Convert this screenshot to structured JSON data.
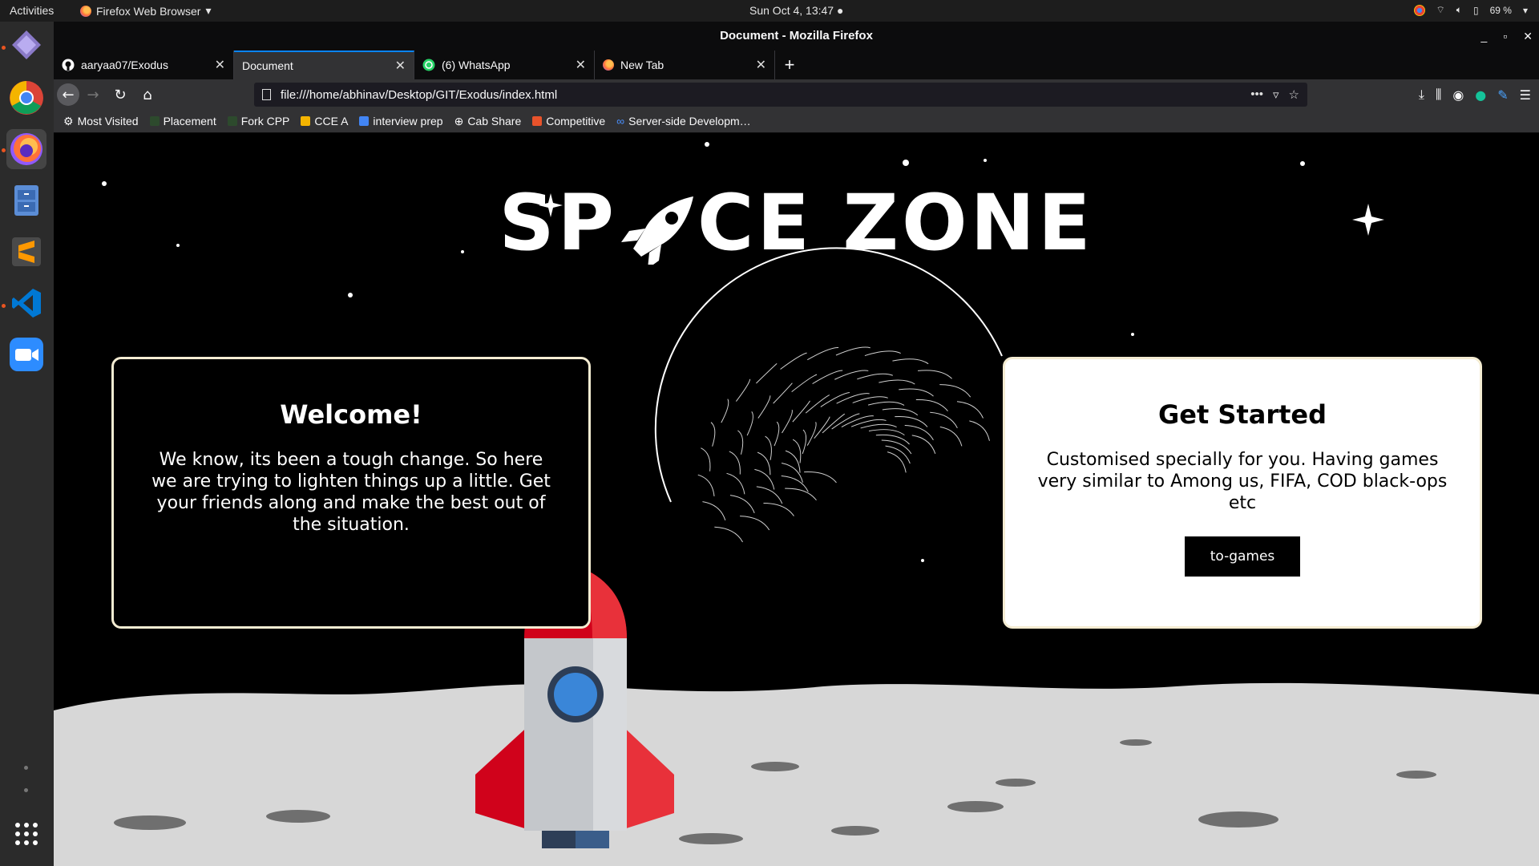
{
  "system": {
    "activities": "Activities",
    "app_menu": "Firefox Web Browser",
    "clock": "Sun Oct  4, 13:47",
    "battery": "69 %"
  },
  "window": {
    "title": "Document - Mozilla Firefox"
  },
  "tabs": [
    {
      "label": "aaryaa07/Exodus",
      "icon": "github-icon"
    },
    {
      "label": "Document",
      "icon": "none"
    },
    {
      "label": "(6) WhatsApp",
      "icon": "whatsapp-icon"
    },
    {
      "label": "New Tab",
      "icon": "firefox-icon"
    }
  ],
  "url": "file:///home/abhinav/Desktop/GIT/Exodus/index.html",
  "bookmarks": [
    {
      "label": "Most Visited",
      "icon": "gear-icon"
    },
    {
      "label": "Placement",
      "icon": "folder-icon"
    },
    {
      "label": "Fork CPP",
      "icon": "folder-icon"
    },
    {
      "label": "CCE A",
      "icon": "classroom-icon"
    },
    {
      "label": "interview prep",
      "icon": "doc-icon"
    },
    {
      "label": "Cab Share",
      "icon": "globe-icon"
    },
    {
      "label": "Competitive",
      "icon": "cube-icon"
    },
    {
      "label": "Server-side Developm…",
      "icon": "infinity-icon"
    }
  ],
  "page": {
    "title_left": "SP",
    "title_right": "CE ZONE",
    "welcome": {
      "heading": "Welcome!",
      "body": "We know, its been a tough change. So here we are trying to lighten things up a little. Get your friends along and make the best out of the situation."
    },
    "started": {
      "heading": "Get Started",
      "body": "Customised specially for you. Having games very similar to Among us, FIFA, COD black-ops etc",
      "button": "to-games"
    }
  },
  "colors": {
    "accent": "#0a84ff",
    "rocket_red": "#d0021b",
    "rocket_body": "#d8dadd",
    "window_blue": "#3a86d8"
  }
}
